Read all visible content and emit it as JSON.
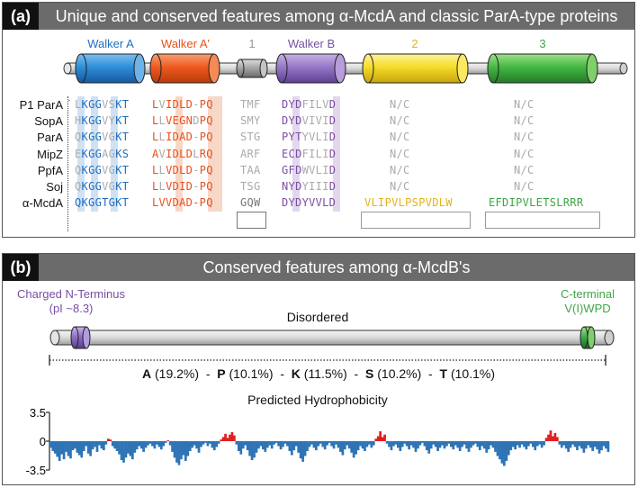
{
  "panel_a": {
    "label": "(a)",
    "title": "Unique and conserved features among α-McdA and classic ParA-type proteins",
    "segments": [
      {
        "name": "Walker A",
        "color": "#1f6fc0"
      },
      {
        "name": "Walker A'",
        "color": "#e8501a"
      },
      {
        "name": "1",
        "color": "#999999"
      },
      {
        "name": "Walker B",
        "color": "#7a4ea3"
      },
      {
        "name": "2",
        "color": "#e2b419"
      },
      {
        "name": "3",
        "color": "#3da646"
      }
    ],
    "proteins": [
      "P1 ParA",
      "SopA",
      "ParA",
      "MipZ",
      "PpfA",
      "Soj",
      "α-McdA"
    ],
    "walker_a": [
      "LKGGVSKT",
      "HKGGVYKT",
      "QKGGVGKT",
      "EKGGAGKS",
      "QKGGVGKT",
      "QKGGVGKT",
      "QKGGTGKT"
    ],
    "walker_a_prime": [
      "LVIDLD-PQ",
      "LLVEGNDPQ",
      "LLIDAD-PQ",
      "AVIDLDLRQ",
      "LLVDLD-PQ",
      "LLVDID-PQ",
      "LVVDAD-PQ"
    ],
    "motif_1": [
      "TMF",
      "SMY",
      "STG",
      "ARF",
      "TAA",
      "TSG",
      "GQW"
    ],
    "walker_b": [
      "DYDFILVD",
      "DYDVIVID",
      "PYTYVLID",
      "ECDFILID",
      "GFDWVLID",
      "NYDYIIID",
      "DYDYVVLD"
    ],
    "motif_2": [
      "N/C",
      "N/C",
      "N/C",
      "N/C",
      "N/C",
      "N/C",
      "VLIPVLPSPVDLW"
    ],
    "motif_3": [
      "N/C",
      "N/C",
      "N/C",
      "N/C",
      "N/C",
      "N/C",
      "EFDIPVLETSLRRR"
    ]
  },
  "panel_b": {
    "label": "(b)",
    "title": "Conserved features among α-McdB's",
    "n_term_label_1": "Charged N-Terminus",
    "n_term_label_2": "(pI ~8.3)",
    "c_term_label_1": "C-terminal",
    "c_term_label_2": "V(I)WPD",
    "disordered_label": "Disordered",
    "composition": [
      {
        "aa": "A",
        "pct": "(19.2%)"
      },
      {
        "aa": "P",
        "pct": "(10.1%)"
      },
      {
        "aa": "K",
        "pct": "(11.5%)"
      },
      {
        "aa": "S",
        "pct": "(10.2%)"
      },
      {
        "aa": "T",
        "pct": "(10.1%)"
      }
    ],
    "separator": "-",
    "hydro_title": "Predicted Hydrophobicity",
    "hydro_ticks": [
      "3.5",
      "0",
      "-3.5"
    ],
    "colors": {
      "n_term": "#8a6bc0",
      "c_term": "#3da646",
      "positive": "#e02020",
      "negative": "#2f74b5"
    }
  },
  "chart_data": {
    "type": "bar",
    "title": "Predicted Hydrophobicity",
    "ylim": [
      -3.5,
      3.5
    ],
    "yticks": [
      3.5,
      0,
      -3.5
    ],
    "values": [
      -0.8,
      -1.2,
      -1.5,
      -1.9,
      -2.4,
      -1.6,
      -2.2,
      -1.3,
      -1.8,
      -2.1,
      -1.1,
      -0.9,
      -1.4,
      -1.7,
      -2.0,
      -1.2,
      -0.6,
      -1.5,
      -1.8,
      -1.0,
      -0.7,
      -1.3,
      -0.5,
      -0.9,
      -1.1,
      -0.4,
      0.3,
      0.2,
      -0.6,
      -0.9,
      -1.2,
      -1.6,
      -2.3,
      -2.6,
      -2.0,
      -1.5,
      -1.8,
      -2.2,
      -1.4,
      -1.0,
      -0.6,
      -0.9,
      -1.3,
      -0.8,
      -0.5,
      -0.3,
      -0.6,
      -0.9,
      -0.4,
      -0.7,
      -1.0,
      -0.6,
      -0.2,
      0.1,
      -0.5,
      -1.3,
      -2.0,
      -2.6,
      -2.9,
      -2.2,
      -1.7,
      -2.4,
      -1.8,
      -1.2,
      -0.8,
      -0.5,
      -0.9,
      -1.4,
      -0.7,
      -0.4,
      -0.2,
      -0.6,
      -0.3,
      -0.8,
      -1.1,
      -0.7,
      -0.3,
      0.2,
      0.5,
      0.9,
      0.4,
      0.8,
      1.1,
      0.7,
      -0.4,
      -1.2,
      -1.6,
      -0.9,
      -0.5,
      -1.1,
      -1.8,
      -2.3,
      -2.0,
      -1.4,
      -0.9,
      -0.6,
      -1.0,
      -1.3,
      -0.8,
      -0.5,
      -0.9,
      -0.4,
      -0.2,
      -0.6,
      -1.0,
      -0.7,
      -0.3,
      -0.6,
      -1.2,
      -1.7,
      -1.1,
      -0.6,
      -1.4,
      -2.1,
      -2.5,
      -1.8,
      -1.2,
      -0.7,
      -0.4,
      -0.8,
      -1.1,
      -0.6,
      -0.3,
      -0.7,
      -1.0,
      -0.5,
      -0.2,
      -0.6,
      -0.9,
      -0.4,
      -0.8,
      -1.3,
      -1.7,
      -1.0,
      -0.5,
      -0.9,
      -1.4,
      -2.0,
      -1.6,
      -1.1,
      -0.6,
      -0.9,
      -1.2,
      -0.7,
      -0.4,
      -0.8,
      -0.5,
      0.3,
      0.6,
      1.2,
      0.5,
      0.8,
      -0.3,
      -0.7,
      -1.1,
      -0.6,
      -0.4,
      -0.8,
      -1.2,
      -0.7,
      -0.3,
      -0.6,
      -1.0,
      -0.5,
      -0.8,
      -1.3,
      -0.9,
      -0.5,
      -0.2,
      -0.6,
      -1.1,
      -1.5,
      -0.9,
      -0.4,
      -0.7,
      -1.2,
      -0.8,
      -0.5,
      -0.9,
      -0.6,
      -0.3,
      -0.7,
      -1.0,
      -0.5,
      -0.8,
      -1.2,
      -0.7,
      -0.4,
      -0.9,
      -1.3,
      -0.8,
      -0.5,
      -0.3,
      -0.7,
      -1.1,
      -0.6,
      -0.9,
      -1.4,
      -1.0,
      -0.5,
      -0.8,
      -1.3,
      -1.8,
      -2.2,
      -2.7,
      -3.0,
      -2.4,
      -1.7,
      -1.1,
      -0.7,
      -1.0,
      -0.5,
      -0.8,
      -0.4,
      -0.7,
      -1.0,
      -0.6,
      -0.3,
      -0.7,
      -1.1,
      -0.6,
      -0.4,
      -0.8,
      -0.5,
      0.4,
      0.8,
      1.3,
      0.6,
      1.0,
      0.5,
      -0.4,
      -0.8,
      -0.5,
      -0.9,
      -1.3,
      -0.8,
      -0.4,
      -0.7,
      -1.1,
      -0.6,
      -0.9,
      -1.4,
      -0.9,
      -0.5,
      -0.8,
      -1.2,
      -0.7,
      -1.0,
      -1.5,
      -1.1,
      -0.6,
      -0.9,
      -1.3
    ]
  }
}
